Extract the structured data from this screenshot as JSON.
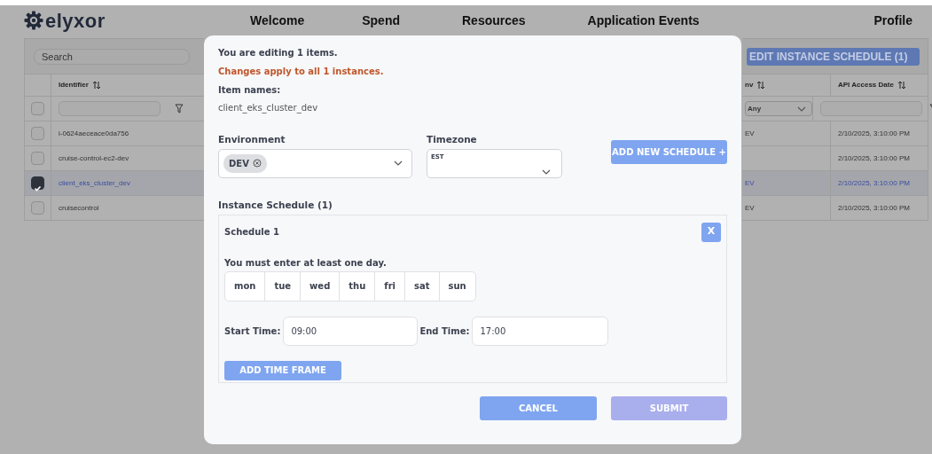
{
  "brand": {
    "name": "elyxor"
  },
  "nav": [
    {
      "label": "Welcome"
    },
    {
      "label": "Spend"
    },
    {
      "label": "Resources"
    },
    {
      "label": "Application Events"
    },
    {
      "label": "Profile"
    }
  ],
  "table": {
    "search": {
      "placeholder": "Search"
    },
    "action_button": "EDIT INSTANCE SCHEDULE (1)",
    "all_checked": false,
    "columns": [
      {
        "label": "Identifier",
        "kind": "text"
      },
      {
        "label": "nv",
        "kind": "select",
        "filter_value": "Any"
      },
      {
        "label": "API Access Date",
        "kind": "text"
      }
    ],
    "rows": [
      {
        "selected": false,
        "identifier": "i-0624aeceace0da756",
        "env": "EV",
        "api_access_date": "2/10/2025, 3:10:00 PM"
      },
      {
        "selected": false,
        "identifier": "cruise-control-ec2-dev",
        "api_access_date": "2/10/2025, 3:10:00 PM"
      },
      {
        "selected": true,
        "identifier": "client_eks_cluster_dev",
        "env": "EV",
        "api_access_date": "2/10/2025, 3:10:00 PM"
      },
      {
        "selected": false,
        "identifier": "cruisecontrol",
        "env": "EV",
        "api_access_date": "2/10/2025, 3:10:00 PM"
      }
    ]
  },
  "modal": {
    "intro": "You are editing 1 items.",
    "warning": "Changes apply to all 1 instances.",
    "item_names_label": "Item names:",
    "item_names": "client_eks_cluster_dev",
    "environment": {
      "label": "Environment",
      "tags": [
        "DEV"
      ]
    },
    "timezone": {
      "label": "Timezone",
      "value": "EST"
    },
    "add_schedule_button": "ADD NEW SCHEDULE +",
    "schedule_heading": "Instance Schedule (1)",
    "schedules": [
      {
        "title": "Schedule 1",
        "remove": "X",
        "warning": "You must enter at least one day.",
        "days": [
          {
            "label": "mon",
            "selected": false
          },
          {
            "label": "tue",
            "selected": false
          },
          {
            "label": "wed",
            "selected": false
          },
          {
            "label": "thu",
            "selected": false
          },
          {
            "label": "fri",
            "selected": false
          },
          {
            "label": "sat",
            "selected": false
          },
          {
            "label": "sun",
            "selected": false
          }
        ],
        "start_label": "Start Time:",
        "start": "09:00",
        "end_label": "End Time:",
        "end": "17:00",
        "add_time_frame": "ADD TIME FRAME"
      }
    ],
    "cancel": "CANCEL",
    "submit": {
      "label": "SUBMIT",
      "disabled": true
    }
  }
}
